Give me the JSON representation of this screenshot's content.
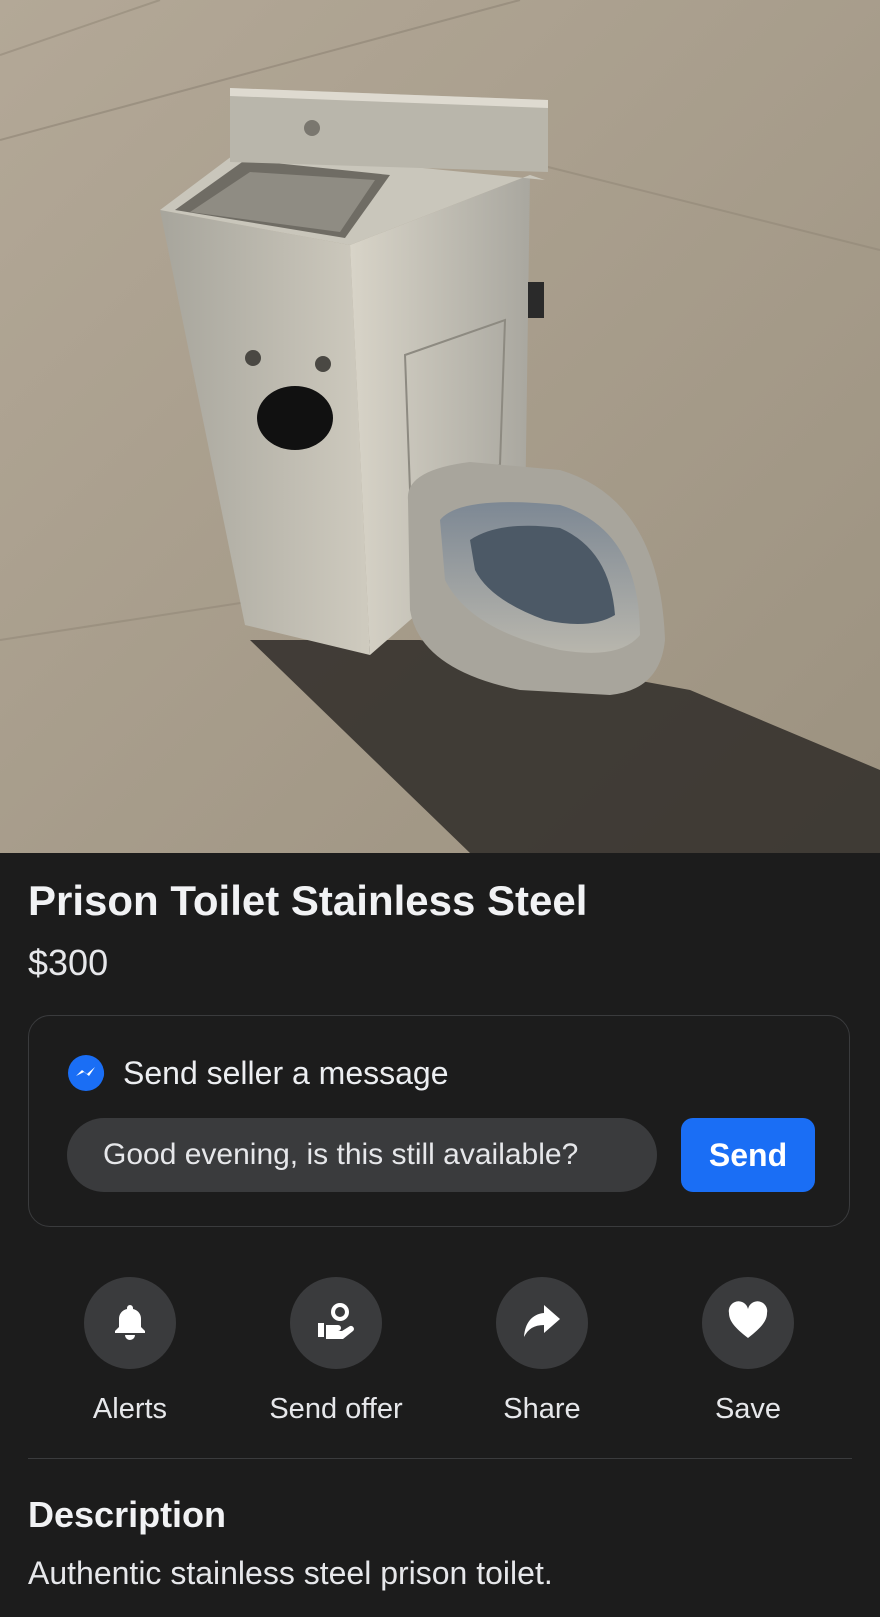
{
  "listing": {
    "title": "Prison Toilet Stainless Steel",
    "price": "$300"
  },
  "message_box": {
    "heading": "Send seller a message",
    "input_value": "Good evening, is this still available?",
    "send_label": "Send",
    "icon": "messenger-icon"
  },
  "actions": [
    {
      "label": "Alerts",
      "icon": "bell-icon"
    },
    {
      "label": "Send offer",
      "icon": "send-offer-icon"
    },
    {
      "label": "Share",
      "icon": "share-arrow-icon"
    },
    {
      "label": "Save",
      "icon": "heart-icon"
    }
  ],
  "description": {
    "heading": "Description",
    "text": "Authentic stainless steel prison toilet."
  },
  "colors": {
    "background": "#1c1c1c",
    "accent": "#1a6ef5",
    "chip": "#3a3b3d"
  }
}
